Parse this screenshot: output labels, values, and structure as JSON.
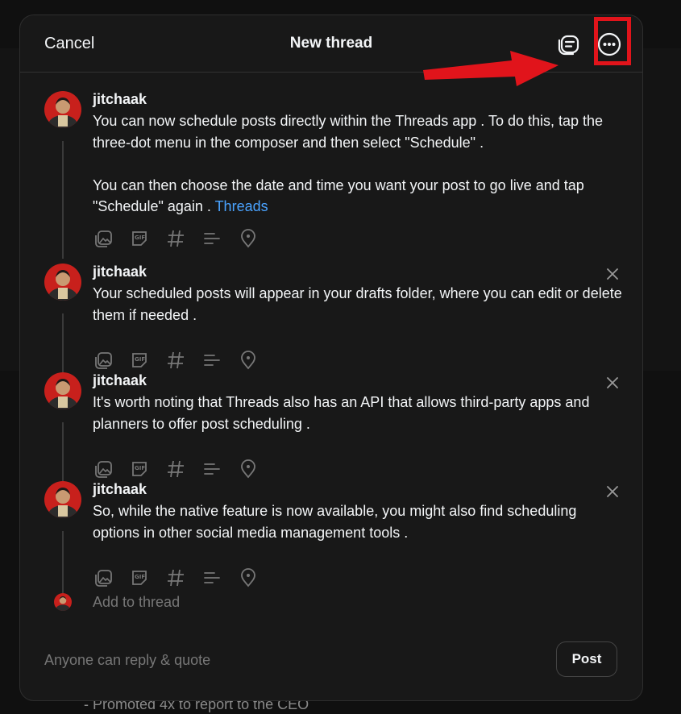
{
  "header": {
    "cancel_label": "Cancel",
    "title": "New thread"
  },
  "annotation": {
    "arrow_color": "#e1141b",
    "highlight_target": "more-options-icon"
  },
  "posts": [
    {
      "username": "jitchaak",
      "text": "You can now schedule posts directly within the Threads app . To do this, tap the three-dot menu in the composer and then select \"Schedule\" .\n\nYou can then choose the date and time you want your post to go live and tap \"Schedule\" again . ",
      "link": "Threads",
      "removable": false
    },
    {
      "username": "jitchaak",
      "text": "Your scheduled posts will appear in your drafts folder, where you can edit or delete them if needed .",
      "removable": true
    },
    {
      "username": "jitchaak",
      "text": "It's worth noting that Threads also has an API that allows third-party apps and planners to offer post scheduling .",
      "removable": true
    },
    {
      "username": "jitchaak",
      "text": "So, while the native feature is now available, you might also find scheduling options in other social media management tools .",
      "removable": true
    }
  ],
  "tools": [
    "image-gallery-icon",
    "gif-icon",
    "hashtag-icon",
    "poll-icon",
    "location-icon"
  ],
  "add_thread_placeholder": "Add to thread",
  "footer": {
    "reply_setting": "Anyone can reply & quote",
    "post_label": "Post"
  },
  "background": {
    "partial_text": "- Promoted 4x to report to the CEO"
  },
  "colors": {
    "modal_bg": "#181818",
    "link": "#4aa3ff",
    "text": "#f3f5f7",
    "muted": "#777777",
    "annotation_red": "#e1141b"
  }
}
